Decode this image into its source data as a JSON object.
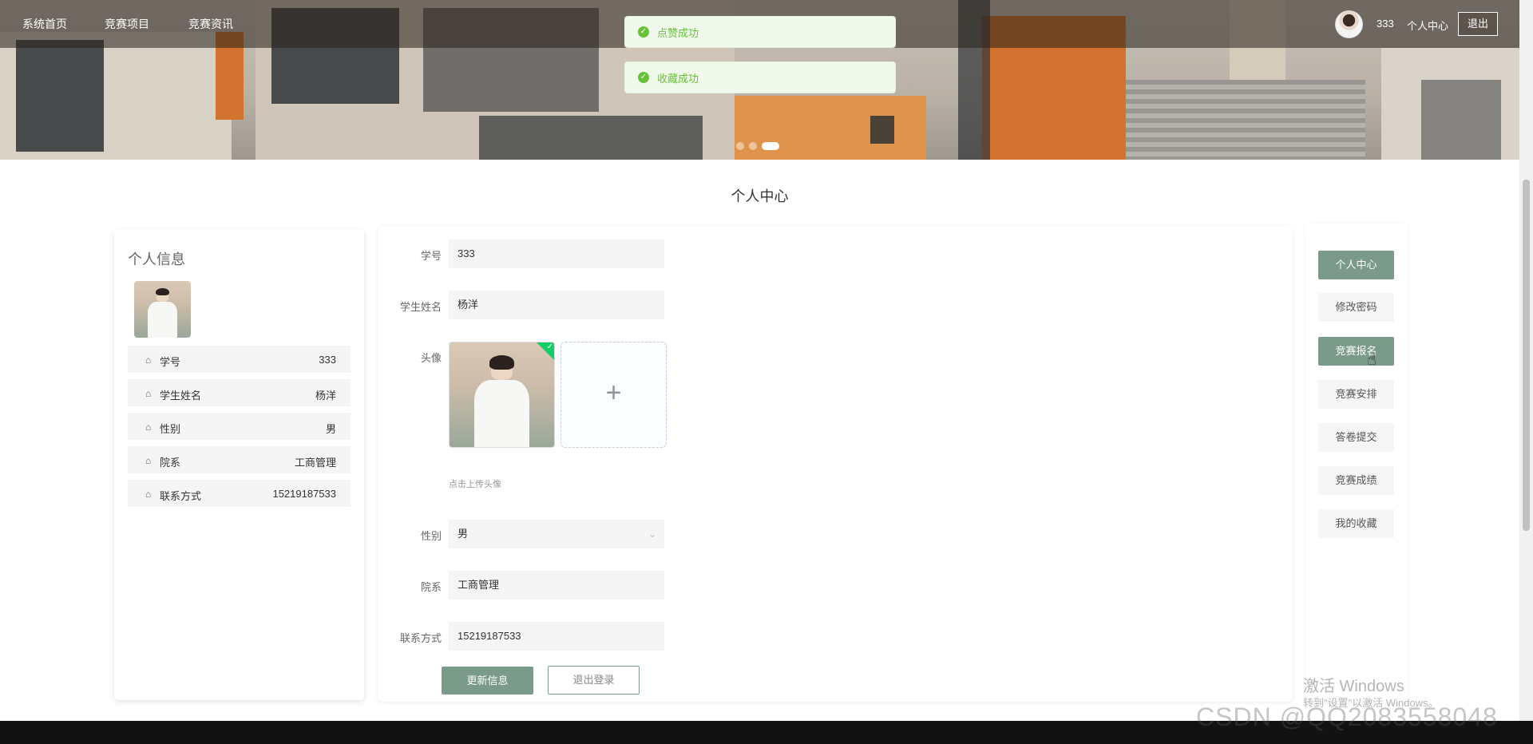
{
  "nav": {
    "items": [
      "系统首页",
      "竞赛项目",
      "竞赛资讯"
    ],
    "username": "333",
    "profile_link": "个人中心",
    "logout": "退出"
  },
  "toasts": [
    "点赞成功",
    "收藏成功"
  ],
  "carousel": {
    "dot_count": 3,
    "active_index": 2
  },
  "page_title": "个人中心",
  "profile_card": {
    "title": "个人信息",
    "rows": [
      {
        "label": "学号",
        "value": "333"
      },
      {
        "label": "学生姓名",
        "value": "杨洋"
      },
      {
        "label": "性别",
        "value": "男"
      },
      {
        "label": "院系",
        "value": "工商管理"
      },
      {
        "label": "联系方式",
        "value": "15219187533"
      }
    ]
  },
  "form": {
    "student_id": {
      "label": "学号",
      "value": "333"
    },
    "student_name": {
      "label": "学生姓名",
      "value": "杨洋"
    },
    "avatar": {
      "label": "头像",
      "hint": "点击上传头像",
      "plus": "+"
    },
    "gender": {
      "label": "性别",
      "value": "男"
    },
    "department": {
      "label": "院系",
      "value": "工商管理"
    },
    "contact": {
      "label": "联系方式",
      "value": "15219187533"
    },
    "update_button": "更新信息",
    "logout_button": "退出登录"
  },
  "side_menu": {
    "items": [
      "个人中心",
      "修改密码",
      "竞赛报名",
      "竞赛安排",
      "答卷提交",
      "竞赛成绩",
      "我的收藏"
    ],
    "active": [
      "个人中心",
      "竞赛报名"
    ]
  },
  "watermarks": {
    "activate_title": "激活 Windows",
    "activate_sub": "转到\"设置\"以激活 Windows。",
    "csdn": "CSDN @QQ2083558048"
  },
  "colors": {
    "accent": "#7a9a8a",
    "success": "#67c23a"
  }
}
